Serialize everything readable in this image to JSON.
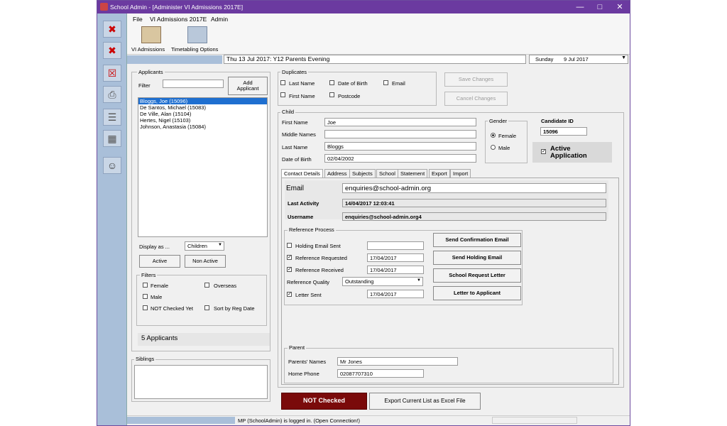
{
  "window": {
    "title": "School Admin - [Administer VI Admissions 2017E]"
  },
  "menu": {
    "file": "File",
    "module": "VI Admissions 2017E",
    "admin": "Admin"
  },
  "toolbar": {
    "admissions": "VI Admissions",
    "timetabling": "Timetabling Options"
  },
  "event_bar": {
    "event": "Thu 13 Jul 2017: Y12 Parents Evening",
    "date_day": "Sunday",
    "date_value": "9 Jul 2017"
  },
  "applicants": {
    "group_label": "Applicants",
    "filter_label": "Filter",
    "filter_value": "",
    "add_button": "Add\nApplicant",
    "items": [
      "Bloggs, Joe (15096)",
      "De Santos, Michael (15083)",
      "De Ville, Alan (15104)",
      "Hertes, Nigel (15103)",
      "Johnson, Anastasia (15084)"
    ],
    "display_as_label": "Display as ...",
    "display_as_value": "Children",
    "active_button": "Active",
    "non_active_button": "Non Active",
    "filters_label": "Filters",
    "filter_female": "Female",
    "filter_male": "Male",
    "filter_overseas": "Overseas",
    "filter_not_checked": "NOT Checked Yet",
    "filter_sort": "Sort by Reg Date",
    "count": "5 Applicants",
    "siblings_label": "Siblings"
  },
  "duplicates": {
    "label": "Duplicates",
    "last_name": "Last Name",
    "dob": "Date of Birth",
    "email": "Email",
    "first_name": "First Name",
    "postcode": "Postcode"
  },
  "actions": {
    "save": "Save Changes",
    "cancel": "Cancel Changes"
  },
  "child": {
    "label": "Child",
    "first_name_label": "First Name",
    "first_name": "Joe",
    "middle_names_label": "Middle Names",
    "middle_names": "",
    "last_name_label": "Last Name",
    "last_name": "Bloggs",
    "dob_label": "Date of Birth",
    "dob": "02/04/2002",
    "gender_label": "Gender",
    "female": "Female",
    "male": "Male",
    "candidate_id_label": "Candidate ID",
    "candidate_id": "15096",
    "active_application": "Active\nApplication"
  },
  "tabs": [
    "Contact Details",
    "Address",
    "Subjects",
    "School",
    "Statement",
    "Export",
    "Import"
  ],
  "contact": {
    "email_label": "Email",
    "email": "enquiries@school-admin.org",
    "last_activity_label": "Last Activity",
    "last_activity": "14/04/2017 12:03:41",
    "username_label": "Username",
    "username": "enquiries@school-admin.org4"
  },
  "reference": {
    "label": "Reference Process",
    "holding_email": "Holding Email Sent",
    "holding_email_value": "",
    "requested": "Reference Requested",
    "requested_value": "17/04/2017",
    "received": "Reference Received",
    "received_value": "17/04/2017",
    "quality": "Reference Quality",
    "quality_value": "Outstanding",
    "letter_sent": "Letter Sent",
    "letter_sent_value": "17/04/2017",
    "btn_confirm": "Send Confirmation Email",
    "btn_holding": "Send Holding Email",
    "btn_school": "School Request Letter",
    "btn_letter": "Letter to Applicant"
  },
  "parent": {
    "label": "Parent",
    "names_label": "Parents' Names",
    "names": "Mr Jones",
    "phone_label": "Home Phone",
    "phone": "02087707310"
  },
  "footer": {
    "not_checked": "NOT Checked",
    "export": "Export Current List as Excel File"
  },
  "status": {
    "text": "MP (SchoolAdmin) is logged in. (Open Connection!)"
  },
  "colors": {
    "title": "#6b3aa0",
    "not_checked": "#7a0a0a",
    "selected": "#1f6fd0",
    "sidebar": "#a9bfd9"
  }
}
